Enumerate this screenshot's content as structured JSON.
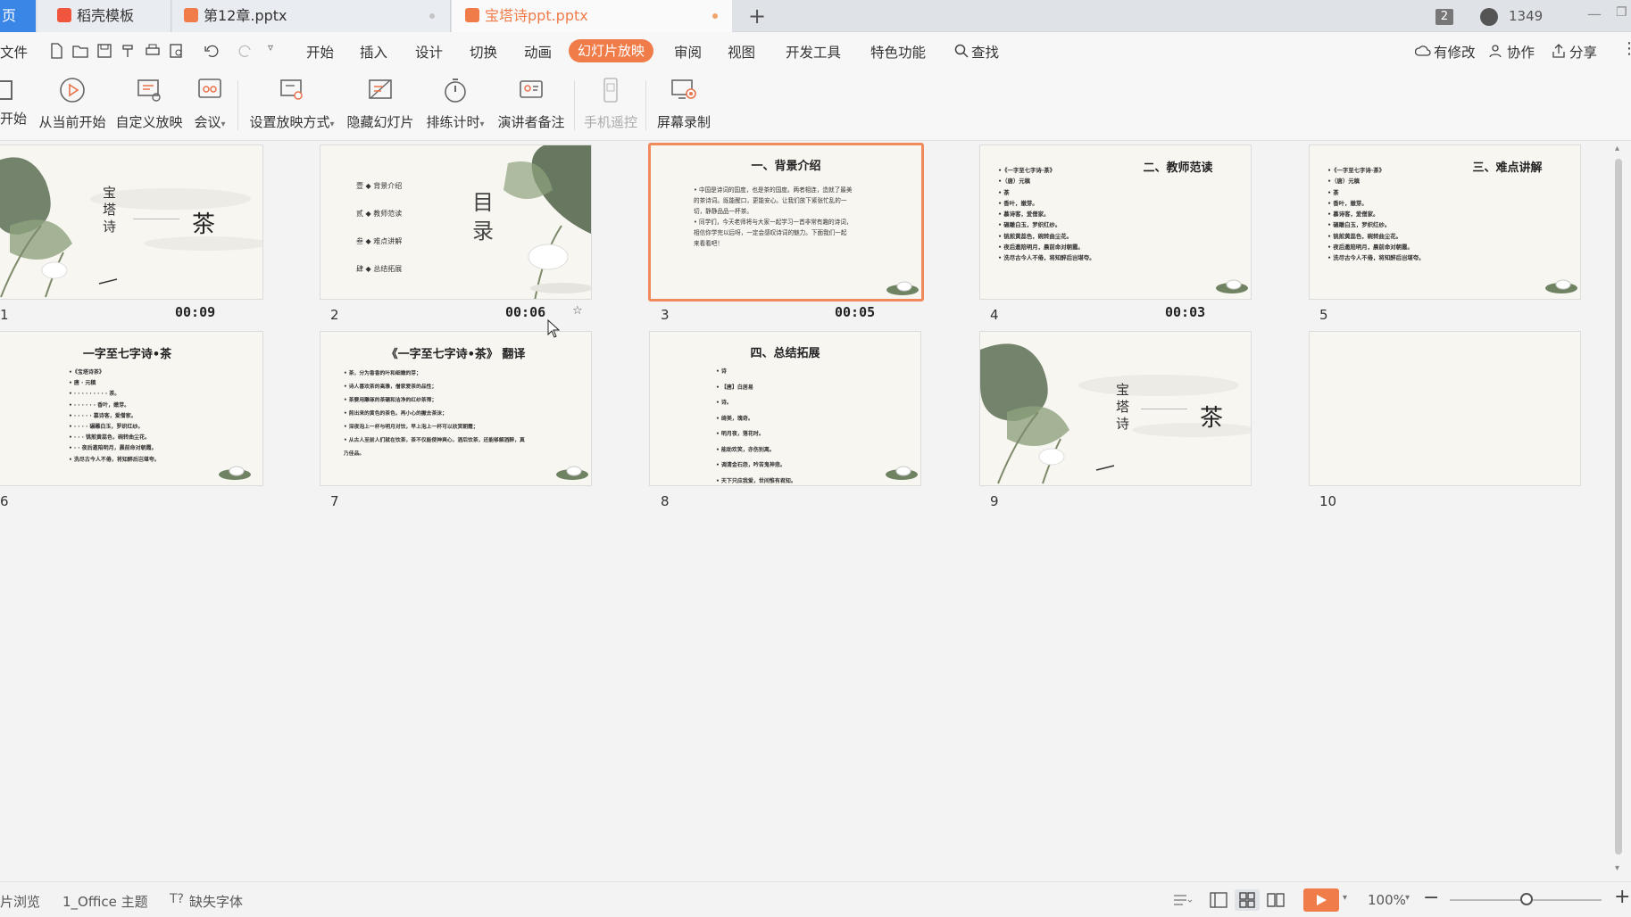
{
  "tabs": [
    {
      "label": "页"
    },
    {
      "label": "稻壳模板"
    },
    {
      "label": "第12章.pptx"
    },
    {
      "label": "宝塔诗ppt.pptx"
    }
  ],
  "titlebar": {
    "badge": "2",
    "user_id": "1349"
  },
  "menu": {
    "file": "文件",
    "items": [
      "开始",
      "插入",
      "设计",
      "切换",
      "动画",
      "幻灯片放映",
      "审阅",
      "视图",
      "开发工具",
      "特色功能"
    ],
    "search": "查找",
    "right": {
      "modified": "有修改",
      "collab": "协作",
      "share": "分享"
    }
  },
  "ribbon": {
    "buttons": [
      "开始",
      "从当前开始",
      "自定义放映",
      "会议",
      "设置放映方式",
      "隐藏幻灯片",
      "排练计时",
      "演讲者备注",
      "手机遥控",
      "屏幕录制"
    ]
  },
  "slides": [
    {
      "num": "1",
      "time": "00:09",
      "title_v": "宝\n塔\n诗",
      "title_main": "茶"
    },
    {
      "num": "2",
      "time": "00:06",
      "toc_big": "目\n录",
      "toc": [
        "壹  ◆  背景介绍",
        "贰  ◆  教师范读",
        "叁  ◆  难点讲解",
        "肆  ◆  总结拓展"
      ],
      "star": "☆"
    },
    {
      "num": "3",
      "time": "00:05",
      "title": "一、背景介绍",
      "lines": [
        "• 中国是诗词的国度，也是茶的国度。两者相连，造就了最美",
        "  的茶诗词。既能醒口，更能安心。让我们放下紧张忙乱的一",
        "  切，静静品品一杯茶。",
        "• 同学们，今天老师将与大家一起学习一首非常有趣的诗词，",
        "  相信你学完以后呀，一定会感叹诗词的魅力。下面我们一起",
        "  来看看吧！"
      ]
    },
    {
      "num": "4",
      "time": "00:03",
      "title": "二、教师范读",
      "lines": [
        "•《一字至七字诗·茶》",
        "•（唐）元稹",
        "• 茶",
        "• 香叶，嫩芽。",
        "• 慕诗客，爱僧家。",
        "• 碾雕白玉，罗织红纱。",
        "• 铫煎黄蕊色，碗转曲尘花。",
        "• 夜后邀陪明月，晨前命对朝霞。",
        "• 洗尽古今人不倦，将知醉后岂堪夸。"
      ]
    },
    {
      "num": "5",
      "title": "三、难点讲解",
      "lines": [
        "•《一字至七字诗·茶》",
        "•（唐）元稹",
        "• 茶",
        "• 香叶，嫩芽。",
        "• 慕诗客，爱僧家。",
        "• 碾雕白玉，罗织红纱。",
        "• 铫煎黄蕊色，碗转曲尘花。",
        "• 夜后邀陪明月，晨前命对朝霞。",
        "• 洗尽古今人不倦，将知醉后岂堪夸。"
      ]
    },
    {
      "num": "6",
      "title": "一字至七字诗•茶",
      "lines": [
        "•《宝塔诗茶》",
        "•                 唐 · 元稹",
        "• · · · · · · · · · 茶。",
        "• · · · · · · 香叶，嫩芽。",
        "• · · · · · 慕诗客，爱僧家。",
        "• · · · · 碾雕白玉，罗织红纱。",
        "• · · · 铫煎黄蕊色，碗转曲尘花。",
        "• · · 夜后邀陪明月，晨前命对朝霞。",
        "• 洗尽古今人不倦，将知醉后岂堪夸。"
      ]
    },
    {
      "num": "7",
      "title": "《一字至七字诗•茶》 翻译",
      "lines": [
        "• 茶，分为香香的叶和细嫩的芽；",
        "• 诗人喜欢茶的高雅，僧家爱茶的品性；",
        "• 茶要用雕琢的茶碾和洁净的红纱茶筛；",
        "• 煎出来的黄色的茶色，再小心的撇去茶沫；",
        "• 深夜泡上一杯与明月对饮，早上泡上一杯可以欣赏朝霞；",
        "• 从古人至前人们就在饮茶，茶不仅能使神爽心，酒后饮茶，还能够解酒醉，真",
        "  乃佳品。"
      ]
    },
    {
      "num": "8",
      "title": "四、总结拓展",
      "lines": [
        "•  诗",
        "•              【唐】白居易",
        "•                   诗。",
        "•               绮美，瑰奇。",
        "•             明月夜，落花时。",
        "•           能助欢笑，亦伤别离。",
        "•         调清金石怨，吟苦鬼神悲。",
        "•       天下只应我爱，世间惟有君知。"
      ]
    },
    {
      "num": "9",
      "title_v": "宝\n塔\n诗",
      "title_main": "茶"
    },
    {
      "num": "10"
    }
  ],
  "status": {
    "browse": "片浏览",
    "theme": "1_Office 主题",
    "missing_font": "缺失字体",
    "zoom": "100%"
  },
  "colors": {
    "accent": "#f08a5d",
    "active_menu": "#f07c4a"
  }
}
